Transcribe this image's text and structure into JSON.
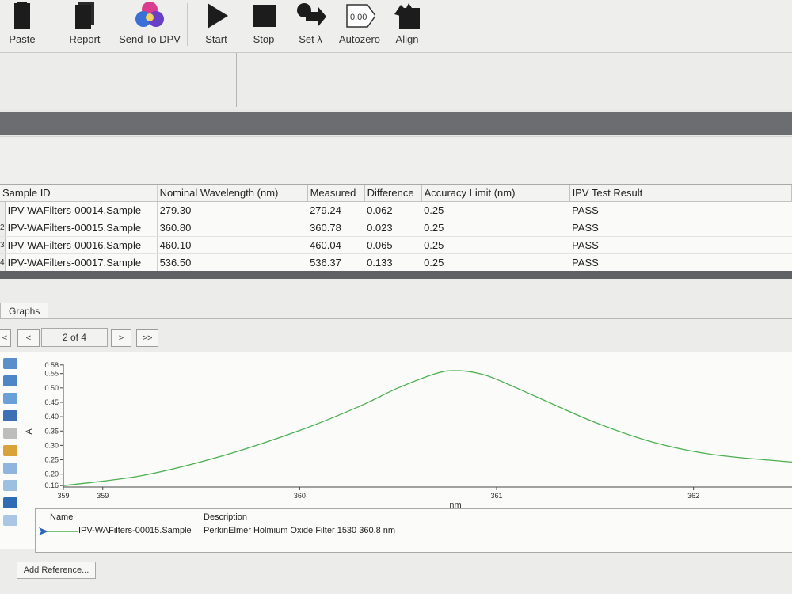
{
  "toolbar": {
    "buttons": [
      {
        "label": "Paste",
        "icon": "paste-icon"
      },
      {
        "label": "Report",
        "icon": "report-icon"
      },
      {
        "label": "Send To DPV",
        "icon": "send-to-dpv-icon"
      },
      {
        "label": "Start",
        "icon": "play-icon"
      },
      {
        "label": "Stop",
        "icon": "stop-icon"
      },
      {
        "label": "Set λ",
        "icon": "set-lambda-icon"
      },
      {
        "label": "Autozero",
        "icon": "autozero-icon",
        "icon_text": "0.00"
      },
      {
        "label": "Align",
        "icon": "align-icon"
      }
    ]
  },
  "results": {
    "columns": [
      "Sample ID",
      "Nominal Wavelength (nm)",
      "Measured",
      "Difference",
      "Accuracy Limit (nm)",
      "IPV Test Result"
    ],
    "rows": [
      {
        "n": "",
        "id": "IPV-WAFilters-00014.Sample",
        "nominal": "279.30",
        "measured": "279.24",
        "diff": "0.062",
        "limit": "0.25",
        "result": "PASS"
      },
      {
        "n": "2",
        "id": "IPV-WAFilters-00015.Sample",
        "nominal": "360.80",
        "measured": "360.78",
        "diff": "0.023",
        "limit": "0.25",
        "result": "PASS"
      },
      {
        "n": "3",
        "id": "IPV-WAFilters-00016.Sample",
        "nominal": "460.10",
        "measured": "460.04",
        "diff": "0.065",
        "limit": "0.25",
        "result": "PASS"
      },
      {
        "n": "4",
        "id": "IPV-WAFilters-00017.Sample",
        "nominal": "536.50",
        "measured": "536.37",
        "diff": "0.133",
        "limit": "0.25",
        "result": "PASS"
      }
    ]
  },
  "graphs": {
    "tab_label": "Graphs",
    "nav": {
      "first": "<",
      "prev": "<",
      "page": "2 of 4",
      "next": ">",
      "last": ">>"
    },
    "legend": {
      "headers": {
        "name": "Name",
        "description": "Description"
      },
      "entries": [
        {
          "name": "IPV-WAFilters-00015.Sample",
          "description": "PerkinElmer Holmium Oxide Filter 1530 360.8 nm",
          "color": "#4caf50"
        }
      ]
    },
    "add_reference_label": "Add Reference..."
  },
  "chart_data": {
    "type": "line",
    "xlabel": "nm",
    "ylabel": "A",
    "xlim": [
      358.8,
      362.5
    ],
    "ylim": [
      0.155,
      0.585
    ],
    "x_ticks": [
      "359",
      "359",
      "360",
      "361",
      "362"
    ],
    "y_ticks": [
      "0.16",
      "0.20",
      "0.25",
      "0.30",
      "0.35",
      "0.40",
      "0.45",
      "0.50",
      "0.55",
      "0.58"
    ],
    "series": [
      {
        "name": "IPV-WAFilters-00015.Sample",
        "color": "#4caf50",
        "x": [
          358.8,
          359.2,
          359.6,
          360.0,
          360.3,
          360.5,
          360.7,
          360.8,
          360.9,
          361.0,
          361.2,
          361.5,
          361.8,
          362.1,
          362.5
        ],
        "y": [
          0.16,
          0.195,
          0.262,
          0.352,
          0.435,
          0.5,
          0.552,
          0.56,
          0.552,
          0.53,
          0.47,
          0.38,
          0.31,
          0.268,
          0.242
        ]
      }
    ]
  }
}
